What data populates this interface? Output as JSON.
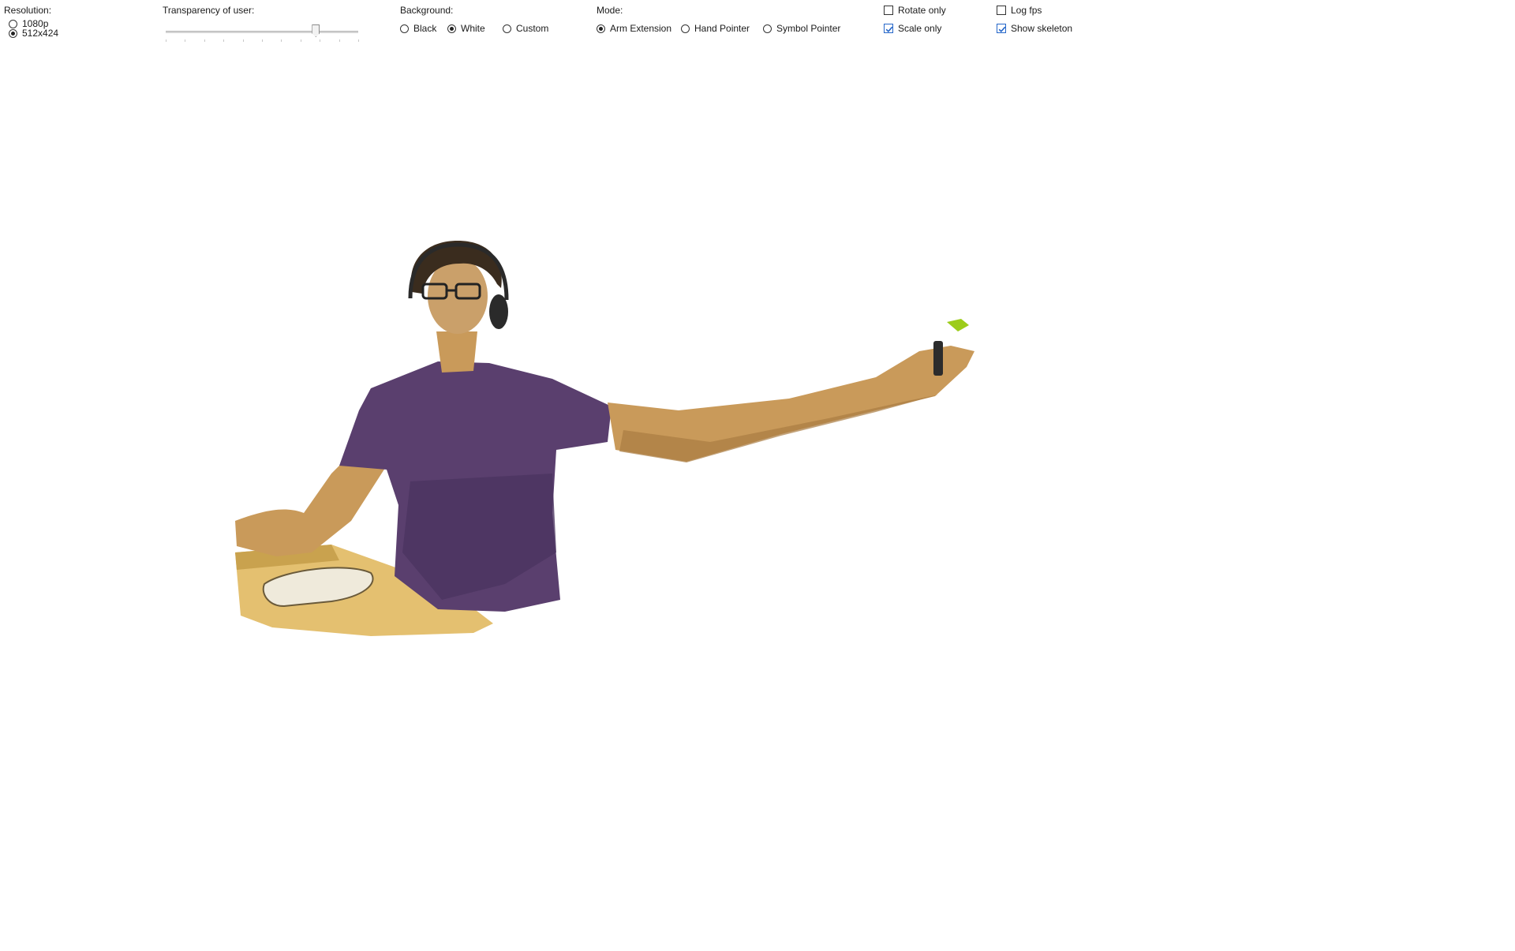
{
  "resolution": {
    "title": "Resolution:",
    "options": [
      "1080p",
      "512x424"
    ],
    "selected": "512x424"
  },
  "transparency": {
    "title": "Transparency of user:",
    "value": 0.78,
    "ticks": 10
  },
  "background": {
    "title": "Background:",
    "options": [
      "Black",
      "White",
      "Custom"
    ],
    "selected": "White"
  },
  "mode": {
    "title": "Mode:",
    "options": [
      "Arm Extension",
      "Hand Pointer",
      "Symbol Pointer"
    ],
    "selected": "Arm Extension"
  },
  "options1": {
    "rotate_only": {
      "label": "Rotate only",
      "checked": false
    },
    "scale_only": {
      "label": "Scale only",
      "checked": true
    }
  },
  "options2": {
    "log_fps": {
      "label": "Log fps",
      "checked": false
    },
    "show_skeleton": {
      "label": "Show skeleton",
      "checked": true
    }
  },
  "colors": {
    "accent": "#2466c9",
    "shirt": "#5a3f6e",
    "skin": "#c99a5a",
    "hair": "#3a2c1e",
    "table": "#e3be6a",
    "pointer": "#9ccc1a"
  },
  "canvas": {
    "content": "user-silhouette"
  }
}
